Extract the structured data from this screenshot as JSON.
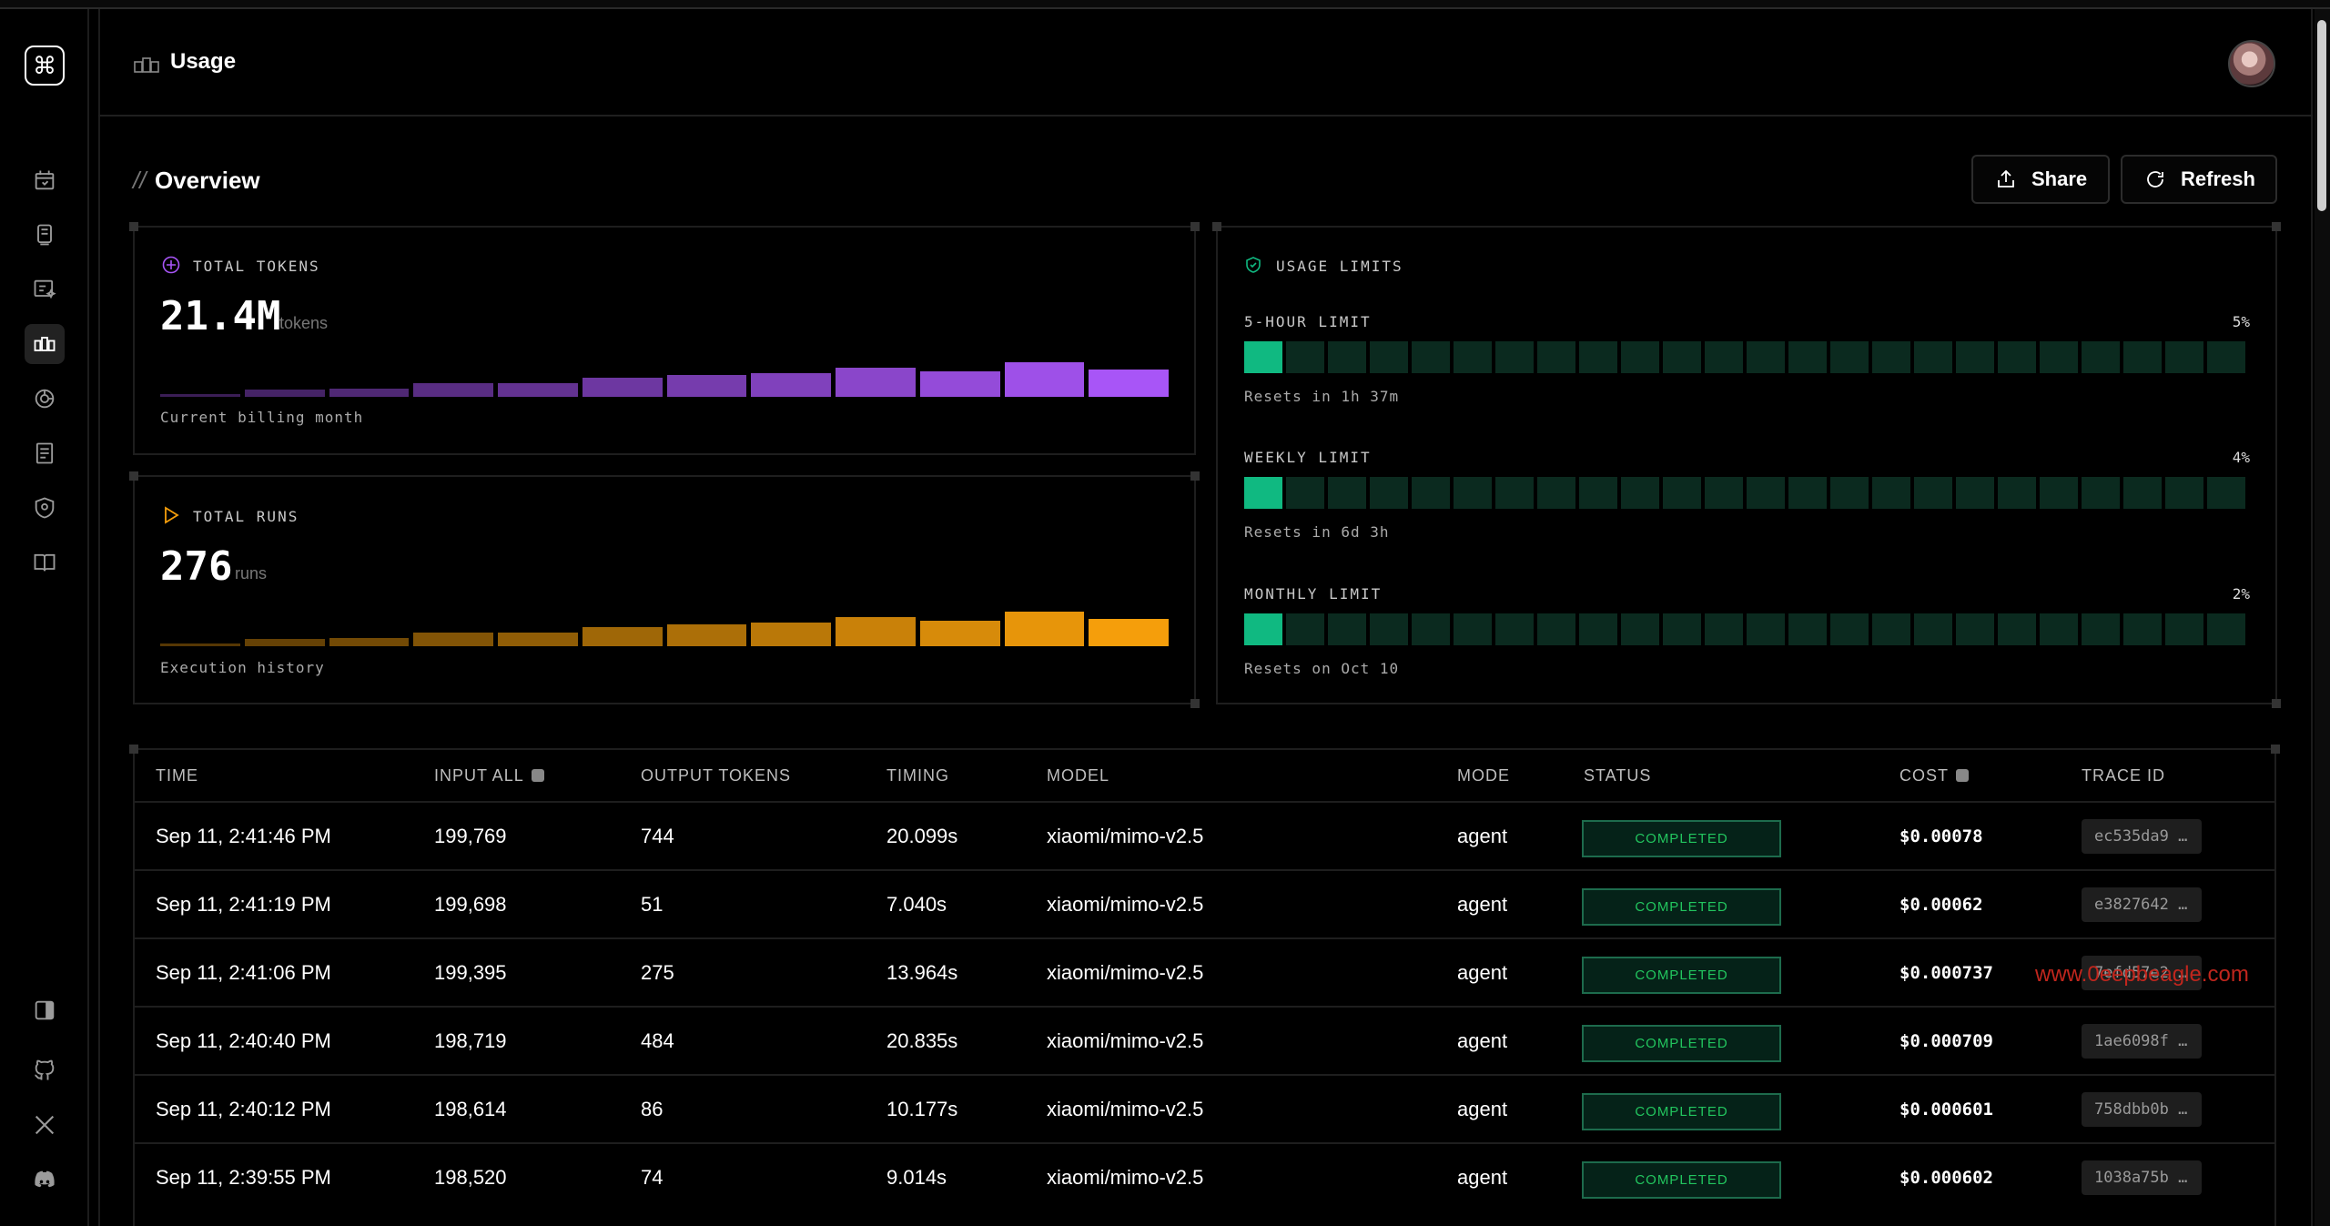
{
  "header": {
    "title": "Usage"
  },
  "overview": {
    "title": "Overview",
    "share_label": "Share",
    "refresh_label": "Refresh"
  },
  "tokens_card": {
    "label": "TOTAL TOKENS",
    "value": "21.4M",
    "unit": "tokens",
    "caption": "Current billing month",
    "accent": "#a855f7",
    "bars": [
      0.05,
      0.2,
      0.25,
      0.4,
      0.4,
      0.55,
      0.62,
      0.68,
      0.85,
      0.75,
      1.0,
      0.78
    ]
  },
  "runs_card": {
    "label": "TOTAL RUNS",
    "value": "276",
    "unit": "runs",
    "caption": "Execution history",
    "accent": "#f59e0b",
    "bars": [
      0.05,
      0.2,
      0.25,
      0.4,
      0.4,
      0.55,
      0.62,
      0.68,
      0.85,
      0.75,
      1.0,
      0.78
    ]
  },
  "limits": {
    "label": "USAGE LIMITS",
    "items": [
      {
        "name": "5-HOUR LIMIT",
        "pct": "5%",
        "fraction": 0.05,
        "reset": "Resets in 1h 37m"
      },
      {
        "name": "WEEKLY LIMIT",
        "pct": "4%",
        "fraction": 0.04,
        "reset": "Resets in 6d 3h"
      },
      {
        "name": "MONTHLY LIMIT",
        "pct": "2%",
        "fraction": 0.02,
        "reset": "Resets on Oct 10"
      }
    ]
  },
  "table": {
    "headers": [
      "TIME",
      "INPUT ALL",
      "OUTPUT TOKENS",
      "TIMING",
      "MODEL",
      "MODE",
      "STATUS",
      "COST",
      "TRACE ID"
    ],
    "rows": [
      {
        "time": "Sep 11, 2:41:46 PM",
        "input": "199,769",
        "output": "744",
        "timing": "20.099s",
        "model": "xiaomi/mimo-v2.5",
        "mode": "agent",
        "status": "COMPLETED",
        "cost": "$0.00078",
        "trace": "ec535da9 …"
      },
      {
        "time": "Sep 11, 2:41:19 PM",
        "input": "199,698",
        "output": "51",
        "timing": "7.040s",
        "model": "xiaomi/mimo-v2.5",
        "mode": "agent",
        "status": "COMPLETED",
        "cost": "$0.00062",
        "trace": "e3827642 …"
      },
      {
        "time": "Sep 11, 2:41:06 PM",
        "input": "199,395",
        "output": "275",
        "timing": "13.964s",
        "model": "xiaomi/mimo-v2.5",
        "mode": "agent",
        "status": "COMPLETED",
        "cost": "$0.000737",
        "trace": "7efd57e2 …"
      },
      {
        "time": "Sep 11, 2:40:40 PM",
        "input": "198,719",
        "output": "484",
        "timing": "20.835s",
        "model": "xiaomi/mimo-v2.5",
        "mode": "agent",
        "status": "COMPLETED",
        "cost": "$0.000709",
        "trace": "1ae6098f …"
      },
      {
        "time": "Sep 11, 2:40:12 PM",
        "input": "198,614",
        "output": "86",
        "timing": "10.177s",
        "model": "xiaomi/mimo-v2.5",
        "mode": "agent",
        "status": "COMPLETED",
        "cost": "$0.000601",
        "trace": "758dbb0b …"
      },
      {
        "time": "Sep 11, 2:39:55 PM",
        "input": "198,520",
        "output": "74",
        "timing": "9.014s",
        "model": "xiaomi/mimo-v2.5",
        "mode": "agent",
        "status": "COMPLETED",
        "cost": "$0.000602",
        "trace": "1038a75b …"
      }
    ]
  },
  "watermark": "www.0eepbeagle.com",
  "sidebar_icons": [
    "dashboard-icon",
    "runs-icon",
    "playground-icon",
    "usage-icon",
    "integrations-icon",
    "logs-icon",
    "security-icon",
    "docs-icon"
  ],
  "footer_icons": [
    "collapse-sidebar-icon",
    "github-icon",
    "x-icon",
    "discord-icon"
  ]
}
